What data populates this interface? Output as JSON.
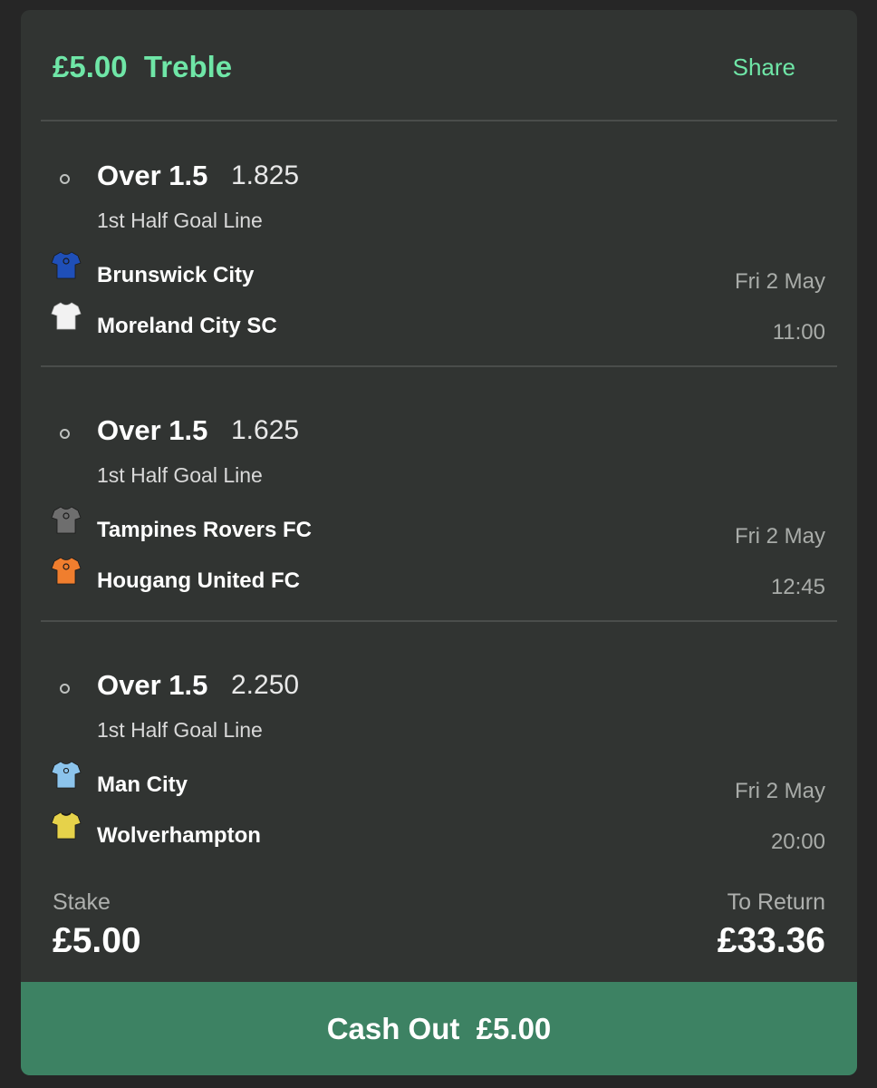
{
  "bet": {
    "title": "£5.00  Treble",
    "share_label": "Share"
  },
  "selections": [
    {
      "market": "Over 1.5",
      "odds": "1.825",
      "market_type": "1st Half Goal Line",
      "home_team": "Brunswick City",
      "away_team": "Moreland City SC",
      "date": "Fri 2 May",
      "time": "11:00",
      "home_kit_color": "#1f4fb8",
      "away_kit_color": "#f2f2f2"
    },
    {
      "market": "Over 1.5",
      "odds": "1.625",
      "market_type": "1st Half Goal Line",
      "home_team": "Tampines Rovers FC",
      "away_team": "Hougang United FC",
      "date": "Fri 2 May",
      "time": "12:45",
      "home_kit_color": "#6e6e6e",
      "away_kit_color": "#f07e2e"
    },
    {
      "market": "Over 1.5",
      "odds": "2.250",
      "market_type": "1st Half Goal Line",
      "home_team": "Man City",
      "away_team": "Wolverhampton",
      "date": "Fri 2 May",
      "time": "20:00",
      "home_kit_color": "#8cc4ec",
      "away_kit_color": "#e6d24a"
    }
  ],
  "summary": {
    "stake_label": "Stake",
    "stake_value": "£5.00",
    "return_label": "To Return",
    "return_value": "£33.36"
  },
  "cashout": {
    "label": "Cash Out  £5.00"
  },
  "colors": {
    "accent": "#6fe6a7",
    "cashout_button": "#3d8263",
    "card_background": "#313432"
  }
}
